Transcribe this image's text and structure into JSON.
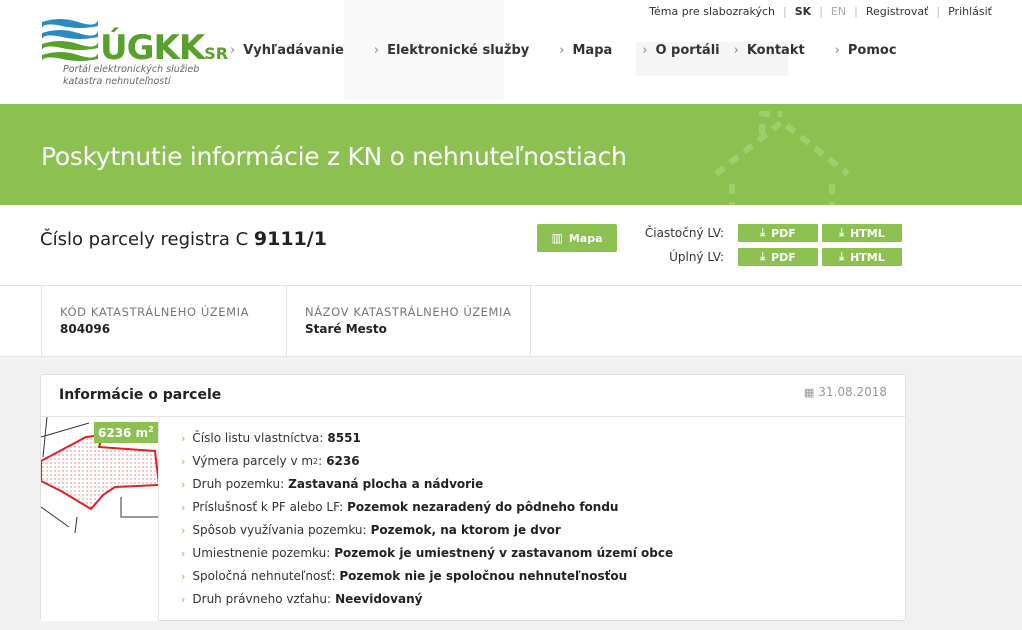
{
  "brand": {
    "name": "ÚGKK",
    "suffix": "SR",
    "tagline": "Portál elektronických služieb katastra nehnuteľností",
    "colors": {
      "green": "#8cc152",
      "blue": "#2a8ac2"
    }
  },
  "topbar": {
    "accessibility": "Téma pre slabozrakých",
    "lang_sk": "SK",
    "lang_en": "EN",
    "register": "Registrovať",
    "login": "Prihlásiť"
  },
  "nav": [
    {
      "label": "Vyhľadávanie"
    },
    {
      "label": "Elektronické služby"
    },
    {
      "label": "Mapa"
    },
    {
      "label": "O portáli"
    },
    {
      "label": "Kontakt"
    },
    {
      "label": "Pomoc"
    }
  ],
  "banner": {
    "title": "Poskytnutie informácie z KN o nehnuteľnostiach"
  },
  "parcel": {
    "title_prefix": "Číslo parcely registra C",
    "number": "9111/1",
    "map_button": "Mapa",
    "partial_lv": "Čiastočný LV:",
    "full_lv": "Úplný LV:",
    "pdf": "PDF",
    "html": "HTML"
  },
  "cadastre": {
    "code_label": "KÓD KATASTRÁLNEHO ÚZEMIA",
    "code_value": "804096",
    "name_label": "NÁZOV KATASTRÁLNEHO ÚZEMIA",
    "name_value": "Staré Mesto"
  },
  "info": {
    "title": "Informácie o parcele",
    "date": "31.08.2018",
    "area_badge": "6236 m",
    "area_badge_sup": "2",
    "rows": [
      {
        "label": "Číslo listu vlastníctva:",
        "value": "8551"
      },
      {
        "label": "Výmera parcely v m",
        "sup": "2",
        "suffix": ":",
        "value": "6236"
      },
      {
        "label": "Druh pozemku:",
        "value": "Zastavaná plocha a nádvorie"
      },
      {
        "label": "Príslušnosť k PF alebo LF:",
        "value": "Pozemok nezaradený do pôdneho fondu"
      },
      {
        "label": "Spôsob využívania pozemku:",
        "value": "Pozemok, na ktorom je dvor"
      },
      {
        "label": "Umiestnenie pozemku:",
        "value": "Pozemok je umiestnený v zastavanom území obce"
      },
      {
        "label": "Spoločná nehnuteľnosť:",
        "value": "Pozemok nie je spoločnou nehnuteľnosťou"
      },
      {
        "label": "Druh právneho vzťahu:",
        "value": "Neevidovaný"
      }
    ]
  }
}
